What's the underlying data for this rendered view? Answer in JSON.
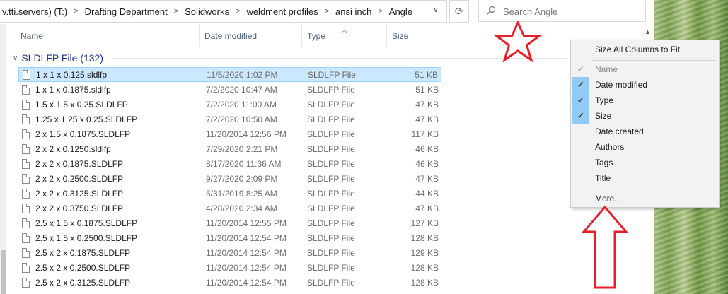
{
  "address": {
    "crumbs": [
      "v.tti.servers) (T:)",
      "Drafting Department",
      "Solidworks",
      "weldment profiles",
      "ansi inch",
      "Angle"
    ],
    "separator": ">",
    "dropdown_glyph": "∨",
    "refresh_glyph": "⟳"
  },
  "search": {
    "placeholder": "Search Angle",
    "icon": "search-icon"
  },
  "columns": {
    "name": "Name",
    "date": "Date modified",
    "type": "Type",
    "size": "Size"
  },
  "group": {
    "label": "SLDLFP File (132)"
  },
  "files": [
    {
      "name": "1 x 1 x 0.125.sldlfp",
      "date": "11/5/2020 1:02 PM",
      "type": "SLDLFP File",
      "size": "51 KB"
    },
    {
      "name": "1 x 1 x 0.1875.sldlfp",
      "date": "7/2/2020 10:47 AM",
      "type": "SLDLFP File",
      "size": "51 KB"
    },
    {
      "name": "1.5 x 1.5 x 0.25.SLDLFP",
      "date": "7/2/2020 11:00 AM",
      "type": "SLDLFP File",
      "size": "47 KB"
    },
    {
      "name": "1.25 x 1.25 x 0.25.SLDLFP",
      "date": "7/2/2020 10:50 AM",
      "type": "SLDLFP File",
      "size": "47 KB"
    },
    {
      "name": "2 x 1.5 x 0.1875.SLDLFP",
      "date": "11/20/2014 12:56 PM",
      "type": "SLDLFP File",
      "size": "117 KB"
    },
    {
      "name": "2 x 2 x 0.1250.sldlfp",
      "date": "7/29/2020 2:21 PM",
      "type": "SLDLFP File",
      "size": "46 KB"
    },
    {
      "name": "2 x 2 x 0.1875.SLDLFP",
      "date": "8/17/2020 11:36 AM",
      "type": "SLDLFP File",
      "size": "46 KB"
    },
    {
      "name": "2 x 2 x 0.2500.SLDLFP",
      "date": "9/27/2020 2:09 PM",
      "type": "SLDLFP File",
      "size": "47 KB"
    },
    {
      "name": "2 x 2 x 0.3125.SLDLFP",
      "date": "5/31/2019 8:25 AM",
      "type": "SLDLFP File",
      "size": "44 KB"
    },
    {
      "name": "2 x 2 x 0.3750.SLDLFP",
      "date": "4/28/2020 2:34 AM",
      "type": "SLDLFP File",
      "size": "47 KB"
    },
    {
      "name": "2.5 x 1.5 x 0.1875.SLDLFP",
      "date": "11/20/2014 12:55 PM",
      "type": "SLDLFP File",
      "size": "127 KB"
    },
    {
      "name": "2.5 x 1.5 x 0.2500.SLDLFP",
      "date": "11/20/2014 12:54 PM",
      "type": "SLDLFP File",
      "size": "128 KB"
    },
    {
      "name": "2.5 x 2 x 0.1875.SLDLFP",
      "date": "11/20/2014 12:54 PM",
      "type": "SLDLFP File",
      "size": "129 KB"
    },
    {
      "name": "2.5 x 2 x 0.2500.SLDLFP",
      "date": "11/20/2014 12:54 PM",
      "type": "SLDLFP File",
      "size": "128 KB"
    },
    {
      "name": "2.5 x 2 x 0.3125.SLDLFP",
      "date": "11/20/2014 12:54 PM",
      "type": "SLDLFP File",
      "size": "128 KB"
    }
  ],
  "context_menu": {
    "fit_label": "Size All Columns to Fit",
    "items": [
      {
        "label": "Name",
        "checked": true,
        "disabled": true
      },
      {
        "label": "Date modified",
        "checked": true,
        "disabled": false
      },
      {
        "label": "Type",
        "checked": true,
        "disabled": false
      },
      {
        "label": "Size",
        "checked": true,
        "disabled": false
      },
      {
        "label": "Date created",
        "checked": false,
        "disabled": false
      },
      {
        "label": "Authors",
        "checked": false,
        "disabled": false
      },
      {
        "label": "Tags",
        "checked": false,
        "disabled": false
      },
      {
        "label": "Title",
        "checked": false,
        "disabled": false
      }
    ],
    "more_label": "More...",
    "check_glyph": "✓"
  },
  "annotations": {
    "color": "#e8202a"
  },
  "colors": {
    "selection_bg": "#cce8ff",
    "selection_border": "#99d1ff",
    "group_text": "#1e3287",
    "header_text": "#4c607a"
  }
}
